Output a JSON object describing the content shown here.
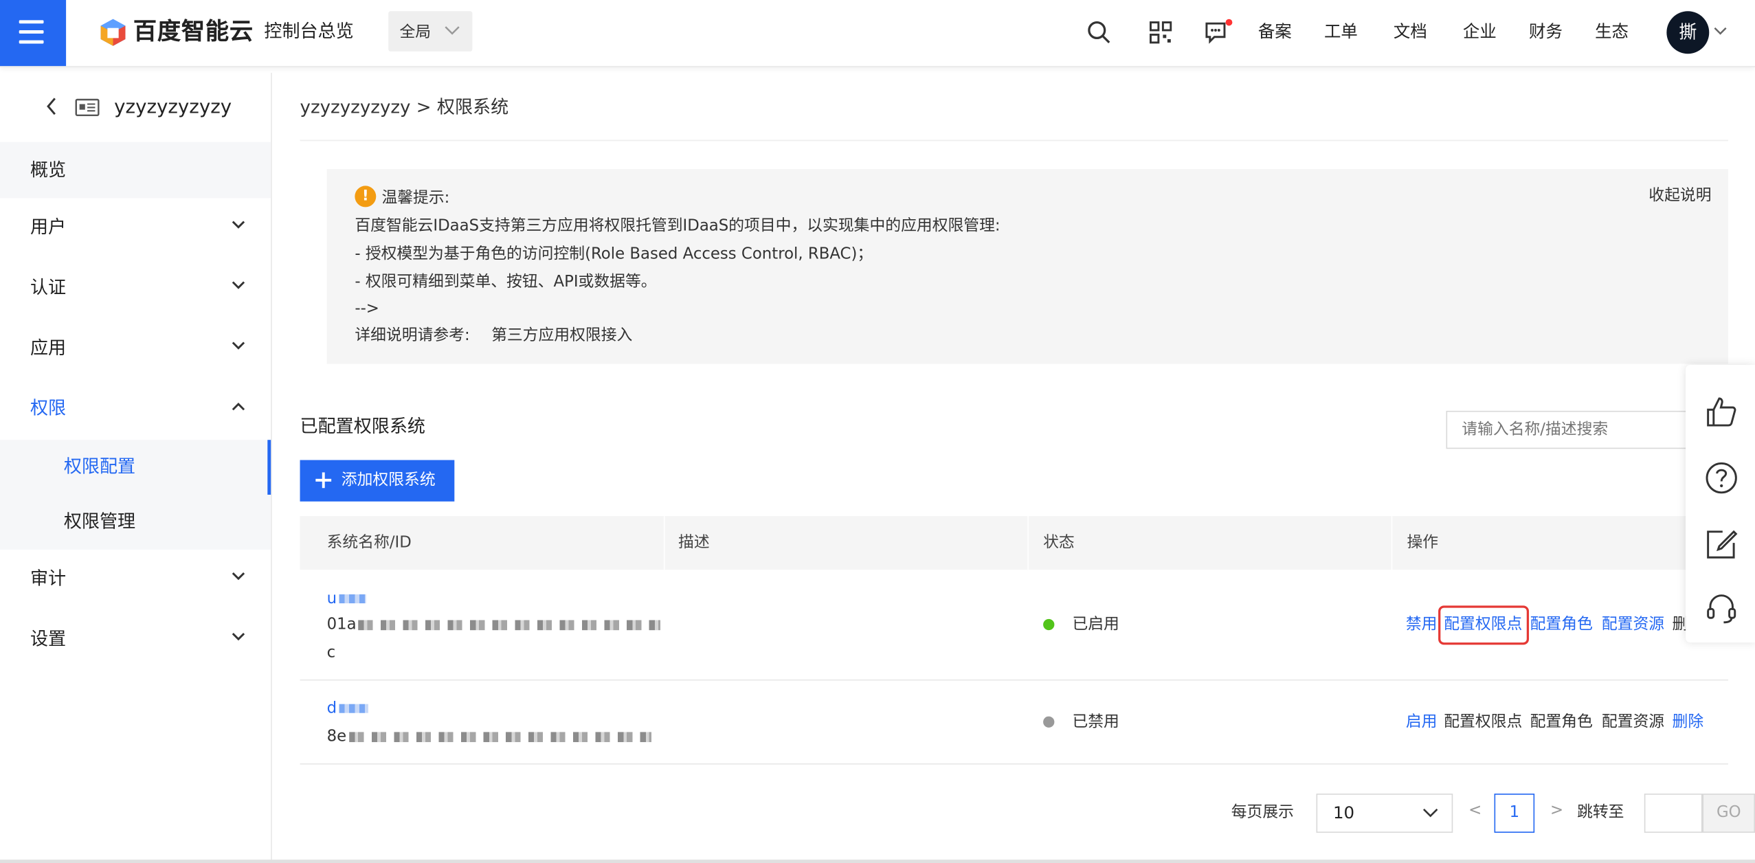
{
  "topbar": {
    "brand": "百度智能云",
    "console_label": "控制台总览",
    "region": "全局",
    "nav": [
      "备案",
      "工单",
      "文档",
      "企业",
      "财务",
      "生态"
    ],
    "avatar_char": "撕",
    "accent": "#2468f2"
  },
  "sidebar": {
    "back_title": "yzyzyzyzyzy",
    "items": [
      {
        "label": "概览"
      },
      {
        "label": "用户"
      },
      {
        "label": "认证"
      },
      {
        "label": "应用"
      },
      {
        "label": "权限"
      },
      {
        "label": "权限配置"
      },
      {
        "label": "权限管理"
      },
      {
        "label": "审计"
      },
      {
        "label": "设置"
      }
    ]
  },
  "main": {
    "breadcrumb": "yzyzyzyzyzy > 权限系统",
    "tips": {
      "title": "温馨提示:",
      "collapse": "收起说明",
      "line1": "百度智能云IDaaS支持第三方应用将权限托管到IDaaS的项目中，以实现集中的应用权限管理:",
      "line2": "- 授权模型为基于角色的访问控制(Role Based Access Control, RBAC)；",
      "line3": "- 权限可精细到菜单、按钮、API或数据等。",
      "line4": "-->",
      "ref_label": "详细说明请参考:",
      "ref_link": "第三方应用权限接入"
    },
    "section_title": "已配置权限系统",
    "search_placeholder": "请输入名称/描述搜索",
    "add_button": "添加权限系统",
    "table": {
      "headers": [
        "系统名称/ID",
        "描述",
        "状态",
        "操作"
      ],
      "rows": [
        {
          "name": "u",
          "id_prefix": "01a",
          "id_tail": "c",
          "status": "已启用",
          "status_color": "#52c41a",
          "actions": [
            "禁用",
            "配置权限点",
            "配置角色",
            "配置资源",
            "删"
          ]
        },
        {
          "name": "d",
          "id_prefix": "8e",
          "status": "已禁用",
          "status_color": "#999999",
          "actions": [
            "启用",
            "配置权限点",
            "配置角色",
            "配置资源",
            "删除"
          ]
        }
      ]
    },
    "pagination": {
      "per_page_label": "每页展示",
      "per_page": "10",
      "prev": "<",
      "page": "1",
      "next": ">",
      "jump_label": "跳转至",
      "go": "GO"
    }
  }
}
